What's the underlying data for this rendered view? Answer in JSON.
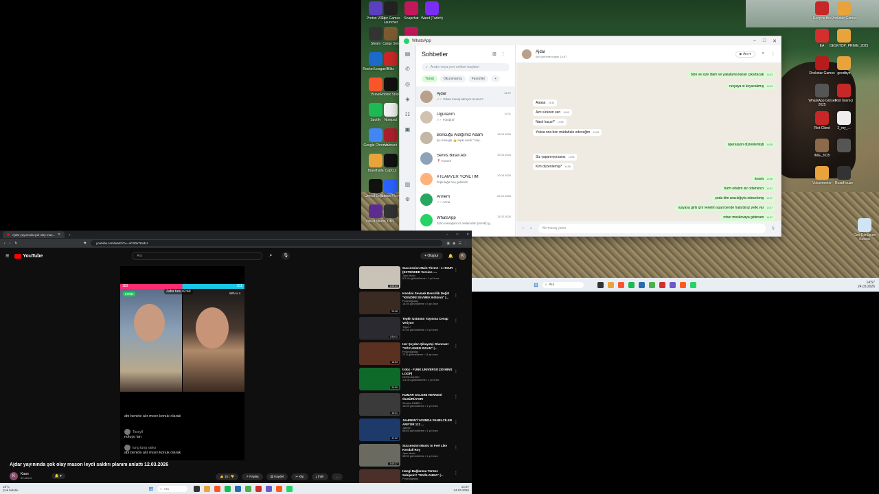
{
  "desktop": {
    "icons_left_col1": [
      "Proton VPN",
      "Steam",
      "Rocket League®",
      "Brave",
      "Spotify",
      "Google Chrome",
      "Brawlhalla",
      "Unreal Engine",
      "Visual Studio"
    ],
    "icons_left_col2": [
      "Epic Games Launcher",
      "Cargo Sim",
      "Blitz",
      "Roblox Studio",
      "Notepad",
      "Valorant",
      "CapCut",
      "Roblox Player",
      "OBS"
    ],
    "icons_left_col3": [
      "Snapchat",
      "",
      "",
      "",
      "",
      "",
      "",
      "",
      ""
    ],
    "icon_wand": "Wand (Twitch)",
    "icons_right": [
      "Recycle Bin",
      "Rockstar Games",
      "EA",
      "DESKTOP_PRIME_2025",
      "Rockstar Games",
      "goodbye",
      "WhatsApp Görsel 2025",
      "Riot İstemci",
      "Riot Client",
      "2_my_...",
      "IMG_2025",
      "",
      "Voicemeeter",
      "RoadHouse"
    ],
    "recycle_label": "Geri Dönüşüm Kutusu"
  },
  "whatsapp": {
    "window_title": "WhatsApp",
    "list_title": "Sohbetler",
    "search_placeholder": "Aratın veya yeni sohbet başlatın",
    "filters": [
      "Tümü",
      "Okunmamış",
      "Favoriler",
      "+"
    ],
    "chats": [
      {
        "name": "Ajdar",
        "preview": "✓✓ Yoksa mesaj atmıyor musun?",
        "time": "14:57"
      },
      {
        "name": "Ogullarım",
        "preview": "✓✓ Fotoğraf",
        "time": "14:11"
      },
      {
        "name": "Boncuğu Aldığımız Adam",
        "preview": "Şu mesajla 👍 tepki verdi: \"Vey...",
        "time": "13.03.2026"
      },
      {
        "name": "Servis Binali Abi",
        "preview": "📍 Konum",
        "time": "10.03.2026"
      },
      {
        "name": "#TEAM7ER YÖNETİM",
        "preview": "Topluluğa hoş geldiniz!",
        "time": "10.03.2026"
      },
      {
        "name": "Annem",
        "preview": "✓✓ Arma",
        "time": "22.02.2026"
      },
      {
        "name": "WhatsApp",
        "preview": "Sizin mesajlarınız reklamdan (ücretli) g...",
        "time": "13.02.2026"
      }
    ],
    "contact_name": "Ajdar",
    "contact_status": "son görülme bugün 14:57",
    "call_label": "Ara",
    "messages": [
      {
        "side": "out",
        "text": "bize ve size idam ve yakalama kararı çıkartacak",
        "time": "14:53"
      },
      {
        "side": "out",
        "text": "rusyaya si koyucakmış",
        "time": "14:53"
      },
      {
        "side": "in",
        "text": "Aaaaa",
        "time": "14:55"
      },
      {
        "side": "in",
        "text": "Azcı ürünen sen",
        "time": "14:55"
      },
      {
        "side": "in",
        "text": "Nasıl kaçar?",
        "time": "14:55"
      },
      {
        "side": "in",
        "text": "Yoksa ona ben müdahale edeceğim",
        "time": "14:55"
      },
      {
        "side": "out",
        "text": "operasyon düzenlemişti",
        "time": "14:55"
      },
      {
        "side": "in",
        "text": "Siz yapamıyorsanız",
        "time": "14:55"
      },
      {
        "side": "in",
        "text": "Kim düzenlemiş?",
        "time": "14:56"
      },
      {
        "side": "out",
        "text": "kravin",
        "time": "14:56"
      },
      {
        "side": "out",
        "text": "bizm odalım siz odamınızı",
        "time": "14:57"
      },
      {
        "side": "out",
        "text": "şeda kim aracılığıyla edecekmiş",
        "time": "14:57"
      },
      {
        "side": "out",
        "text": "rusyaya girls izni verelim suan bende hala biraz yetki var",
        "time": "14:57"
      },
      {
        "side": "out",
        "text": "rober moskovaya gidersen",
        "time": "14:57"
      }
    ],
    "compose_placeholder": "Bir mesaj yazın"
  },
  "browser": {
    "tab_title": "Ajdar yayınında şok olay mas...",
    "url": "youtube.com/watch?v=-oC4Dx7Ka1U",
    "yt_search_placeholder": "Ara",
    "create_label": "Oluştur",
    "avatar_letter": "K",
    "stream": {
      "lose_badge": "LOSE",
      "timer": "Zafer turu 02:40",
      "win_badge": "WIN x 4",
      "left_score": "183",
      "right_score": "311",
      "comments": [
        {
          "user": "",
          "text": "abi benide alır mısın konuk olarak"
        },
        {
          "user": "Toxcyll",
          "text": "noluyo lan"
        },
        {
          "user": "tung tung sahur",
          "text": "abi benide alır mısın konuk olarak"
        }
      ]
    },
    "video_title": "Ajdar yayınında şok olay mason leydi saldırı planını anlattı 12.03.2026",
    "channel_name": "Kaan",
    "subs": "59 abone",
    "likes": "15",
    "actions": [
      "Paylaş",
      "Kaydet",
      "Klip",
      "İndir"
    ],
    "recommendations": [
      {
        "title": "Succession Main Theme - 1 HOUR (EXTENDED Version -...",
        "channel": "Jace Music",
        "meta": "5,2 Mn görüntüleme • 1 yıl önce",
        "dur": "1:00:24",
        "color": "#c9c2b6"
      },
      {
        "title": "Kendini Sevmek Bencillik Değil! \"KENDİNİ SEVMEK Bölümü\" |...",
        "channel": "Pınar Ağrıdoy",
        "meta": "153 B görüntüleme • 5 ay önce",
        "dur": "25:38",
        "color": "#3b2a22"
      },
      {
        "title": "Tepki! Ustünün Yayınına Cevap Veriyor!",
        "channel": "Tepki ✓",
        "meta": "473 B görüntüleme • 3 yıl önce",
        "dur": "2:50:11",
        "color": "#2a2a30"
      },
      {
        "title": "Her Şeyden Şikayetçi Olunmaz! \"SÖYLENEN İNSAN\" |...",
        "channel": "Pınar Ağrıdoy",
        "meta": "72 B görüntüleme • 11 ay önce",
        "dur": "18:53",
        "color": "#5a3020"
      },
      {
        "title": "trobz - FUNK UNIVERSO [30 MINS LOOP]",
        "channel": "KERIN MUSIC",
        "meta": "1,5 Mn görüntüleme • 1 yıl önce",
        "dur": "29:59",
        "color": "#0e6a2a"
      },
      {
        "title": "KUMAR SALGINI HERKESİ ÖLDÜRÜYOR!",
        "channel": "Sedrion EMEB ✓",
        "meta": "154 B görüntüleme • 1 yıl önce",
        "dur": "16:31",
        "color": "#3a3a3a"
      },
      {
        "title": "JAHREIN'İ YAYINDA PANELCİLER ARIYOR 112 ...",
        "channel": "Jahrein",
        "meta": "855 B görüntüleme • 1 yıl önce",
        "dur": "47:02",
        "color": "#1d3a6a"
      },
      {
        "title": "Succession Music to Feel Like Kendall Roy",
        "channel": "Jace Music",
        "meta": "589 B görüntüleme • 1 yıl önce",
        "dur": "1:00:27",
        "color": "#6a6a60"
      },
      {
        "title": "Hangi Bağlanma Türüne Sahipsin? \"BAĞLANMA\" |...",
        "channel": "Pınar Ağrıdoy",
        "meta": "",
        "dur": "",
        "color": "#4a3028"
      }
    ]
  },
  "taskbar": {
    "search_label": "Ara",
    "weather_temp": "18°C",
    "weather_desc": "Çok bulutlu",
    "clock_time": "14:57",
    "clock_date": "24.03.2026"
  }
}
